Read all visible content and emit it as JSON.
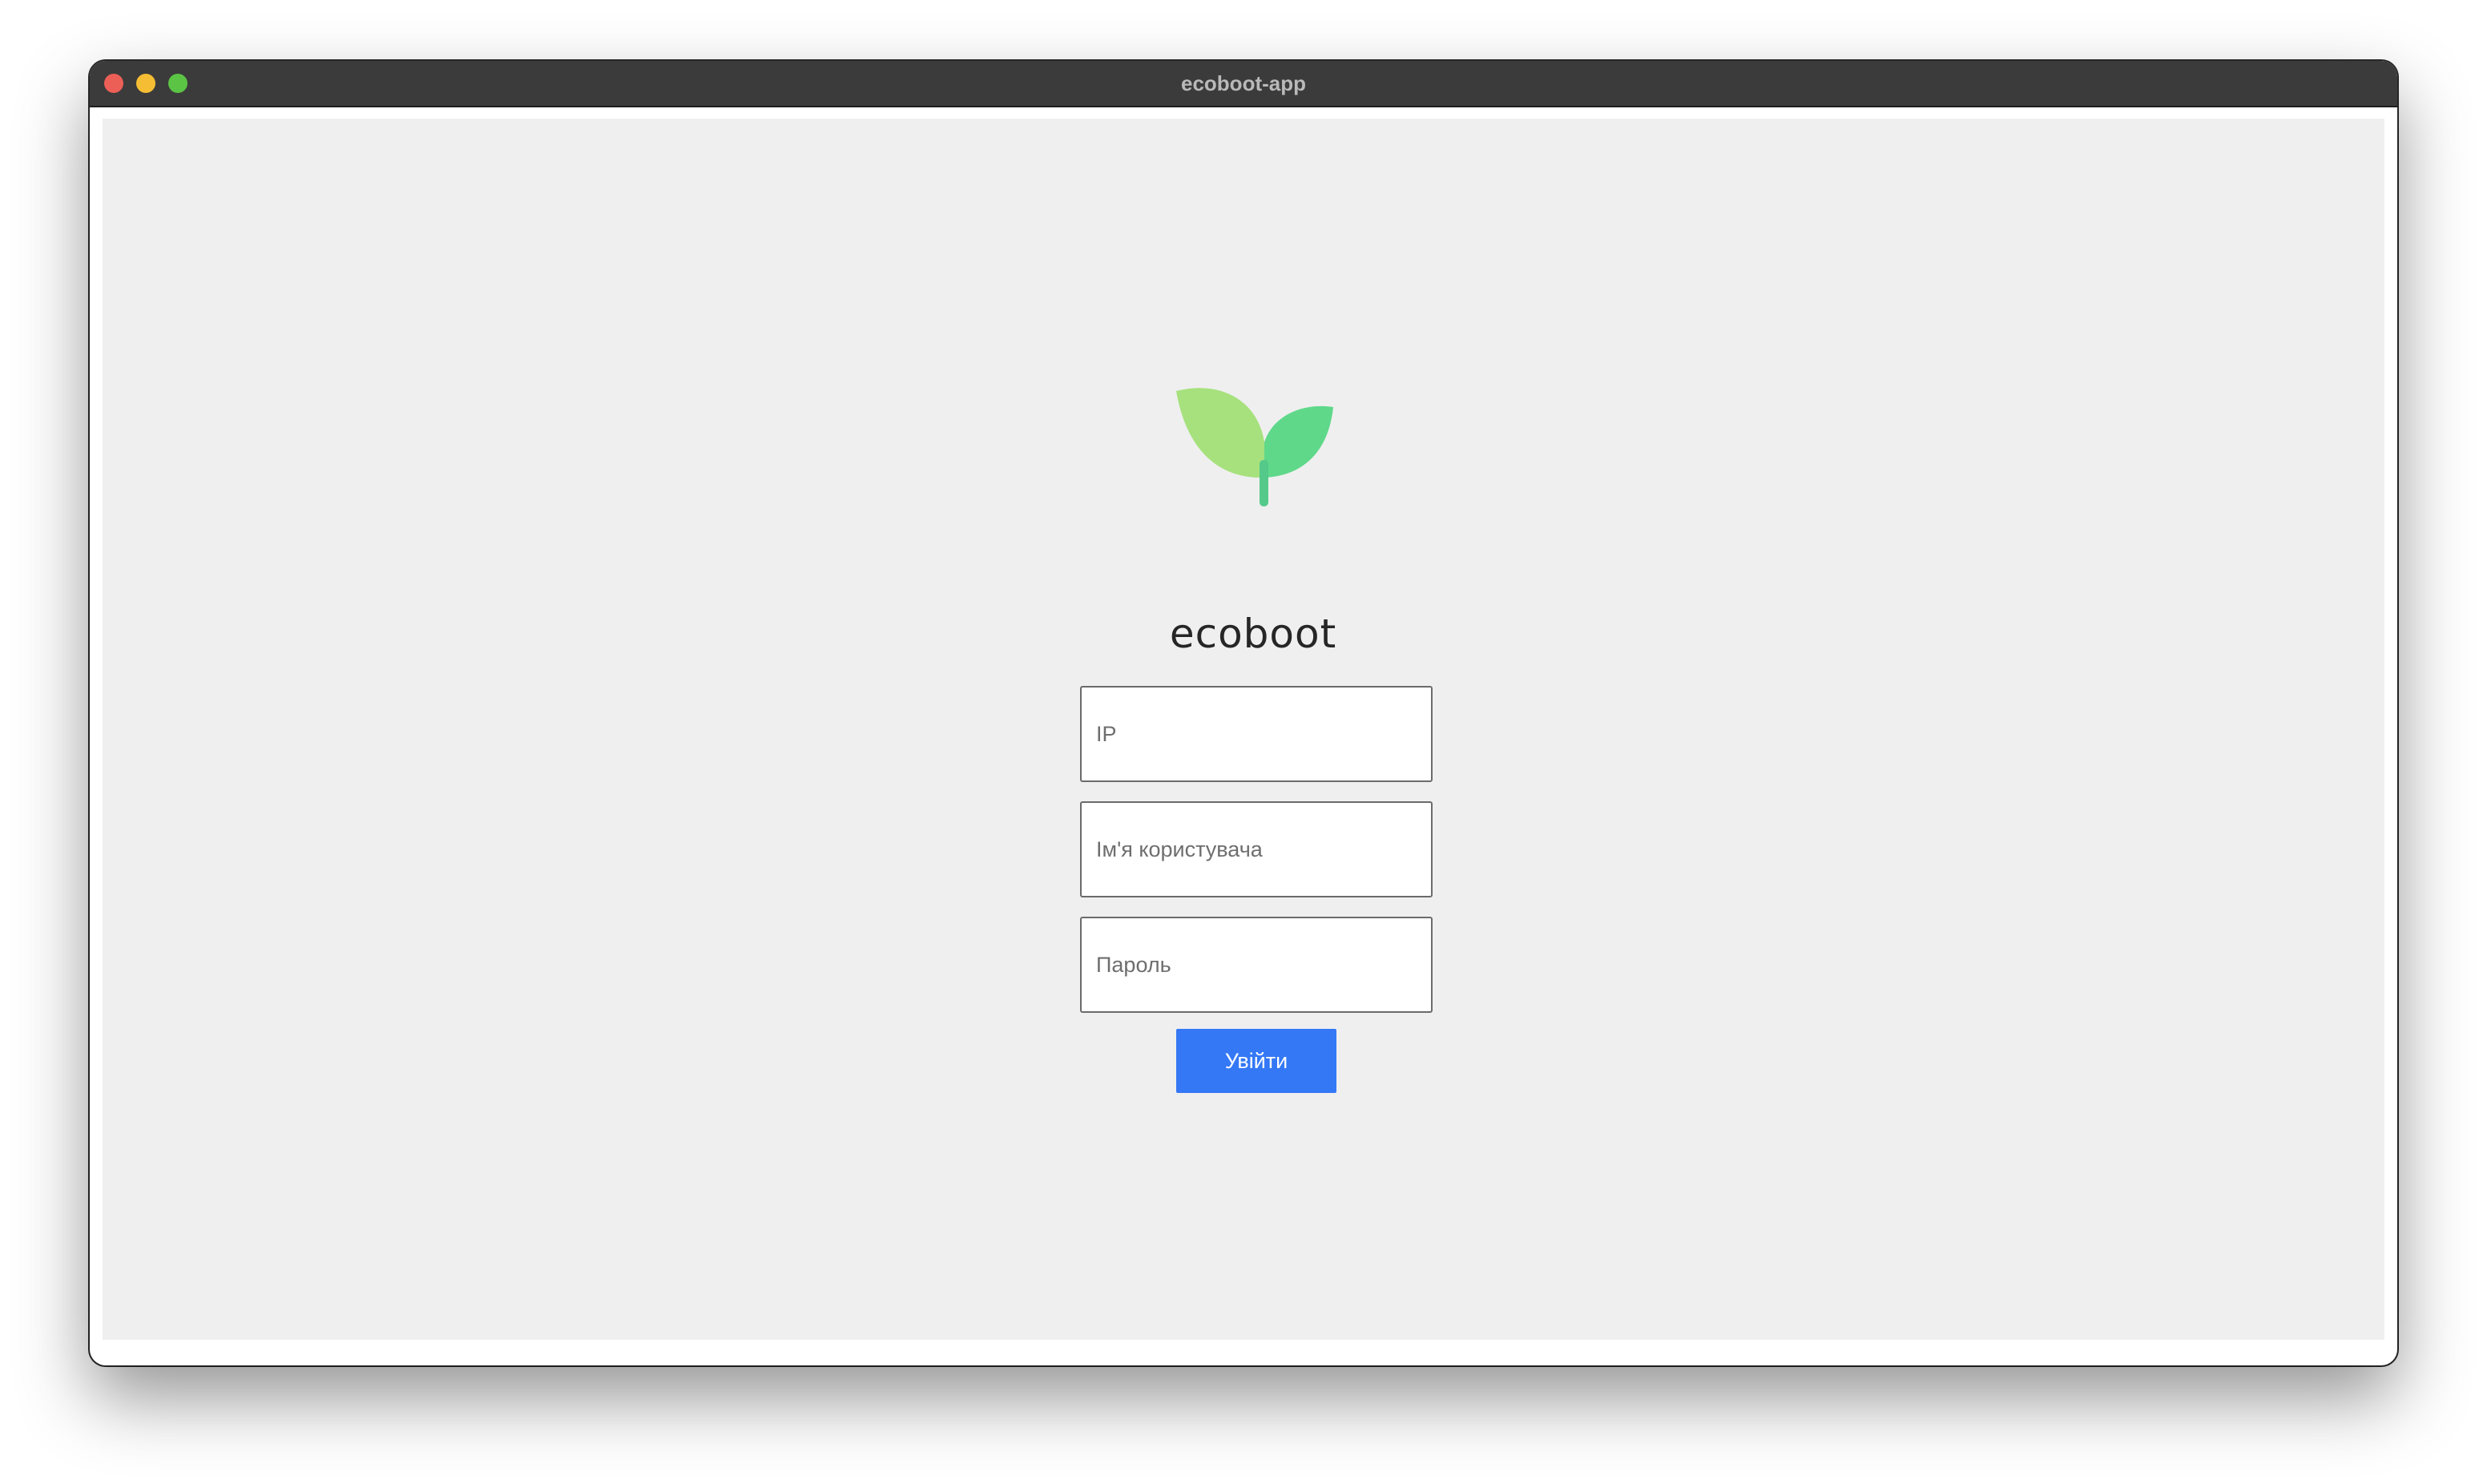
{
  "window": {
    "title": "ecoboot-app"
  },
  "app": {
    "name": "ecoboot",
    "logo_icon": "sprout-leaves-icon",
    "logo_colors": {
      "left_leaf": "#a6e17d",
      "right_leaf": "#5fd88a",
      "stem": "#55c98a"
    }
  },
  "login_form": {
    "ip_placeholder": "IP",
    "ip_value": "",
    "username_placeholder": "Ім'я користувача",
    "username_value": "",
    "password_placeholder": "Пароль",
    "password_value": "",
    "submit_label": "Увійти",
    "submit_color": "#3478f6"
  }
}
